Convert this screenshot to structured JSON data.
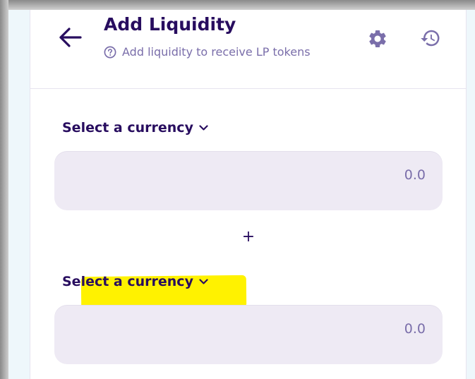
{
  "header": {
    "title": "Add Liquidity",
    "subtitle": "Add liquidity to receive LP tokens"
  },
  "icons": {
    "back": "arrow-left-icon",
    "help": "question-circle-icon",
    "settings": "gear-icon",
    "history": "history-icon",
    "chevron": "chevron-down-icon"
  },
  "token_a": {
    "select_label": "Select a currency",
    "amount_placeholder": "0.0"
  },
  "separator": "+",
  "token_b": {
    "select_label": "Select a currency",
    "amount_placeholder": "0.0",
    "highlighted": true
  },
  "colors": {
    "primary_text": "#280d5f",
    "secondary_text": "#7a6eaa",
    "input_bg": "#eeeaf4",
    "highlight": "#fff200"
  }
}
